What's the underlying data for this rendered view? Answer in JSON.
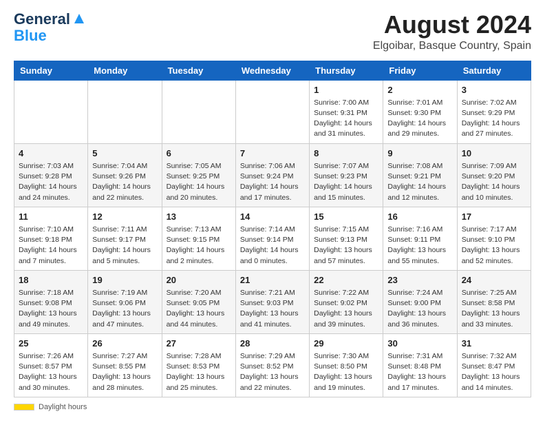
{
  "header": {
    "logo_line1": "General",
    "logo_line2": "Blue",
    "month_year": "August 2024",
    "location": "Elgoibar, Basque Country, Spain"
  },
  "days_of_week": [
    "Sunday",
    "Monday",
    "Tuesday",
    "Wednesday",
    "Thursday",
    "Friday",
    "Saturday"
  ],
  "weeks": [
    [
      {
        "day": "",
        "sunrise": "",
        "sunset": "",
        "daylight": ""
      },
      {
        "day": "",
        "sunrise": "",
        "sunset": "",
        "daylight": ""
      },
      {
        "day": "",
        "sunrise": "",
        "sunset": "",
        "daylight": ""
      },
      {
        "day": "",
        "sunrise": "",
        "sunset": "",
        "daylight": ""
      },
      {
        "day": "1",
        "sunrise": "Sunrise: 7:00 AM",
        "sunset": "Sunset: 9:31 PM",
        "daylight": "Daylight: 14 hours and 31 minutes."
      },
      {
        "day": "2",
        "sunrise": "Sunrise: 7:01 AM",
        "sunset": "Sunset: 9:30 PM",
        "daylight": "Daylight: 14 hours and 29 minutes."
      },
      {
        "day": "3",
        "sunrise": "Sunrise: 7:02 AM",
        "sunset": "Sunset: 9:29 PM",
        "daylight": "Daylight: 14 hours and 27 minutes."
      }
    ],
    [
      {
        "day": "4",
        "sunrise": "Sunrise: 7:03 AM",
        "sunset": "Sunset: 9:28 PM",
        "daylight": "Daylight: 14 hours and 24 minutes."
      },
      {
        "day": "5",
        "sunrise": "Sunrise: 7:04 AM",
        "sunset": "Sunset: 9:26 PM",
        "daylight": "Daylight: 14 hours and 22 minutes."
      },
      {
        "day": "6",
        "sunrise": "Sunrise: 7:05 AM",
        "sunset": "Sunset: 9:25 PM",
        "daylight": "Daylight: 14 hours and 20 minutes."
      },
      {
        "day": "7",
        "sunrise": "Sunrise: 7:06 AM",
        "sunset": "Sunset: 9:24 PM",
        "daylight": "Daylight: 14 hours and 17 minutes."
      },
      {
        "day": "8",
        "sunrise": "Sunrise: 7:07 AM",
        "sunset": "Sunset: 9:23 PM",
        "daylight": "Daylight: 14 hours and 15 minutes."
      },
      {
        "day": "9",
        "sunrise": "Sunrise: 7:08 AM",
        "sunset": "Sunset: 9:21 PM",
        "daylight": "Daylight: 14 hours and 12 minutes."
      },
      {
        "day": "10",
        "sunrise": "Sunrise: 7:09 AM",
        "sunset": "Sunset: 9:20 PM",
        "daylight": "Daylight: 14 hours and 10 minutes."
      }
    ],
    [
      {
        "day": "11",
        "sunrise": "Sunrise: 7:10 AM",
        "sunset": "Sunset: 9:18 PM",
        "daylight": "Daylight: 14 hours and 7 minutes."
      },
      {
        "day": "12",
        "sunrise": "Sunrise: 7:11 AM",
        "sunset": "Sunset: 9:17 PM",
        "daylight": "Daylight: 14 hours and 5 minutes."
      },
      {
        "day": "13",
        "sunrise": "Sunrise: 7:13 AM",
        "sunset": "Sunset: 9:15 PM",
        "daylight": "Daylight: 14 hours and 2 minutes."
      },
      {
        "day": "14",
        "sunrise": "Sunrise: 7:14 AM",
        "sunset": "Sunset: 9:14 PM",
        "daylight": "Daylight: 14 hours and 0 minutes."
      },
      {
        "day": "15",
        "sunrise": "Sunrise: 7:15 AM",
        "sunset": "Sunset: 9:13 PM",
        "daylight": "Daylight: 13 hours and 57 minutes."
      },
      {
        "day": "16",
        "sunrise": "Sunrise: 7:16 AM",
        "sunset": "Sunset: 9:11 PM",
        "daylight": "Daylight: 13 hours and 55 minutes."
      },
      {
        "day": "17",
        "sunrise": "Sunrise: 7:17 AM",
        "sunset": "Sunset: 9:10 PM",
        "daylight": "Daylight: 13 hours and 52 minutes."
      }
    ],
    [
      {
        "day": "18",
        "sunrise": "Sunrise: 7:18 AM",
        "sunset": "Sunset: 9:08 PM",
        "daylight": "Daylight: 13 hours and 49 minutes."
      },
      {
        "day": "19",
        "sunrise": "Sunrise: 7:19 AM",
        "sunset": "Sunset: 9:06 PM",
        "daylight": "Daylight: 13 hours and 47 minutes."
      },
      {
        "day": "20",
        "sunrise": "Sunrise: 7:20 AM",
        "sunset": "Sunset: 9:05 PM",
        "daylight": "Daylight: 13 hours and 44 minutes."
      },
      {
        "day": "21",
        "sunrise": "Sunrise: 7:21 AM",
        "sunset": "Sunset: 9:03 PM",
        "daylight": "Daylight: 13 hours and 41 minutes."
      },
      {
        "day": "22",
        "sunrise": "Sunrise: 7:22 AM",
        "sunset": "Sunset: 9:02 PM",
        "daylight": "Daylight: 13 hours and 39 minutes."
      },
      {
        "day": "23",
        "sunrise": "Sunrise: 7:24 AM",
        "sunset": "Sunset: 9:00 PM",
        "daylight": "Daylight: 13 hours and 36 minutes."
      },
      {
        "day": "24",
        "sunrise": "Sunrise: 7:25 AM",
        "sunset": "Sunset: 8:58 PM",
        "daylight": "Daylight: 13 hours and 33 minutes."
      }
    ],
    [
      {
        "day": "25",
        "sunrise": "Sunrise: 7:26 AM",
        "sunset": "Sunset: 8:57 PM",
        "daylight": "Daylight: 13 hours and 30 minutes."
      },
      {
        "day": "26",
        "sunrise": "Sunrise: 7:27 AM",
        "sunset": "Sunset: 8:55 PM",
        "daylight": "Daylight: 13 hours and 28 minutes."
      },
      {
        "day": "27",
        "sunrise": "Sunrise: 7:28 AM",
        "sunset": "Sunset: 8:53 PM",
        "daylight": "Daylight: 13 hours and 25 minutes."
      },
      {
        "day": "28",
        "sunrise": "Sunrise: 7:29 AM",
        "sunset": "Sunset: 8:52 PM",
        "daylight": "Daylight: 13 hours and 22 minutes."
      },
      {
        "day": "29",
        "sunrise": "Sunrise: 7:30 AM",
        "sunset": "Sunset: 8:50 PM",
        "daylight": "Daylight: 13 hours and 19 minutes."
      },
      {
        "day": "30",
        "sunrise": "Sunrise: 7:31 AM",
        "sunset": "Sunset: 8:48 PM",
        "daylight": "Daylight: 13 hours and 17 minutes."
      },
      {
        "day": "31",
        "sunrise": "Sunrise: 7:32 AM",
        "sunset": "Sunset: 8:47 PM",
        "daylight": "Daylight: 13 hours and 14 minutes."
      }
    ]
  ],
  "footer": {
    "daylight_label": "Daylight hours"
  }
}
